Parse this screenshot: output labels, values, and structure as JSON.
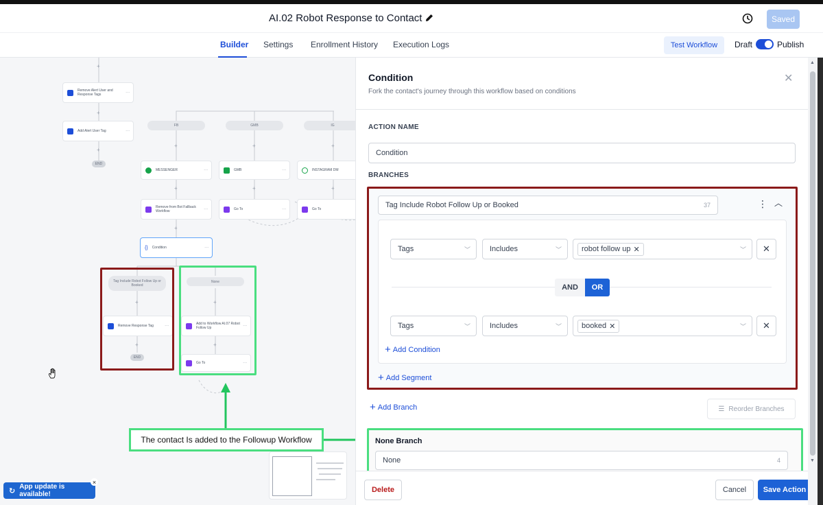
{
  "header": {
    "title": "AI.02 Robot Response to Contact",
    "saved_label": "Saved"
  },
  "tabs": [
    {
      "label": "Builder"
    },
    {
      "label": "Settings"
    },
    {
      "label": "Enrollment History"
    },
    {
      "label": "Execution Logs"
    }
  ],
  "toolbar": {
    "test_label": "Test Workflow",
    "draft_label": "Draft",
    "publish_label": "Publish"
  },
  "canvas": {
    "nodes": {
      "remove_alert": "Remove Alert User and Response Tags",
      "add_alert": "Add Alert User Tag",
      "end1": "END",
      "fb": "FB",
      "gmb": "GMB",
      "ig": "IG",
      "messenger": "MESSENGER",
      "gmb_node": "GMB",
      "instagram": "INSTAGRAM DM",
      "remove_bot": "Remove from Bot Fallback Workflow",
      "goto1": "Go To",
      "goto2": "Go To",
      "condition": "Condition",
      "tag_include": "Tag Include Robot Follow Up or Booked",
      "none_pill": "None",
      "remove_response": "Remove Response Tag",
      "end2": "END",
      "add_workflow": "Add to Workflow AI.07 Robot Follow Up",
      "goto3": "Go To"
    },
    "annotation": "The contact Is added to the Followup Workflow",
    "app_update": "App update is available!"
  },
  "panel": {
    "title": "Condition",
    "subtitle": "Fork the contact's journey through this workflow based on conditions",
    "action_name_label": "ACTION NAME",
    "action_name_value": "Condition",
    "branches_label": "BRANCHES",
    "branch": {
      "name": "Tag Include Robot Follow Up or Booked",
      "count": "37",
      "conditions": [
        {
          "field": "Tags",
          "operator": "Includes",
          "value": "robot follow up"
        },
        {
          "field": "Tags",
          "operator": "Includes",
          "value": "booked"
        }
      ],
      "and_label": "AND",
      "or_label": "OR",
      "add_condition": "Add Condition",
      "add_segment": "Add Segment"
    },
    "add_branch": "Add Branch",
    "reorder_branches": "Reorder Branches",
    "none_branch": {
      "title": "None Branch",
      "value": "None",
      "count": "4"
    },
    "footer": {
      "delete": "Delete",
      "cancel": "Cancel",
      "save": "Save Action"
    }
  },
  "colors": {
    "accent": "#1d62d6",
    "red_highlight": "#8b1a1a",
    "green_highlight": "#4ade80"
  }
}
